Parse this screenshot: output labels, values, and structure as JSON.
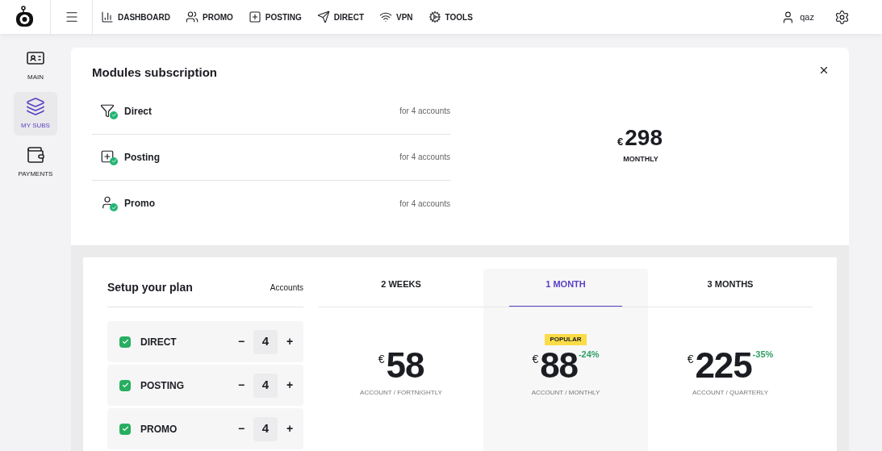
{
  "nav": [
    {
      "label": "DASHBOARD",
      "kind": "dashboard"
    },
    {
      "label": "PROMO",
      "kind": "promo"
    },
    {
      "label": "POSTING",
      "kind": "posting"
    },
    {
      "label": "DIRECT",
      "kind": "direct"
    },
    {
      "label": "VPN",
      "kind": "vpn"
    },
    {
      "label": "TOOLS",
      "kind": "tools"
    }
  ],
  "user": {
    "name": "qaz"
  },
  "sidebar": {
    "items": [
      {
        "label": "MAIN",
        "kind": "main",
        "selected": false
      },
      {
        "label": "MY SUBS",
        "kind": "subs",
        "selected": true
      },
      {
        "label": "PAYMENTS",
        "kind": "payments",
        "selected": false
      }
    ]
  },
  "modules": {
    "title": "Modules subscription",
    "items": [
      {
        "name": "Direct",
        "kind": "direct",
        "note": "for 4 accounts"
      },
      {
        "name": "Posting",
        "kind": "posting",
        "note": "for 4 accounts"
      },
      {
        "name": "Promo",
        "kind": "promo",
        "note": "for 4 accounts"
      }
    ],
    "total": {
      "currency": "€",
      "amount": "298",
      "period": "MONTHLY"
    }
  },
  "setup": {
    "title": "Setup your plan",
    "accounts_label": "Accounts",
    "items": [
      {
        "name": "DIRECT",
        "checked": true,
        "count": "4",
        "minus": "−",
        "plus": "+"
      },
      {
        "name": "POSTING",
        "checked": true,
        "count": "4",
        "minus": "−",
        "plus": "+"
      },
      {
        "name": "PROMO",
        "checked": true,
        "count": "4",
        "minus": "−",
        "plus": "+"
      }
    ]
  },
  "plans": [
    {
      "label": "2 WEEKS",
      "selected": false,
      "currency": "€",
      "price": "58",
      "per": "ACCOUNT / FORTNIGHTLY"
    },
    {
      "label": "1 MONTH",
      "selected": true,
      "badge": "POPULAR",
      "currency": "€",
      "price": "88",
      "discount": "-24%",
      "per": "ACCOUNT / MONTHLY"
    },
    {
      "label": "3 MONTHS",
      "selected": false,
      "currency": "€",
      "price": "225",
      "discount": "-35%",
      "per": "ACCOUNT / QUARTERLY"
    }
  ]
}
